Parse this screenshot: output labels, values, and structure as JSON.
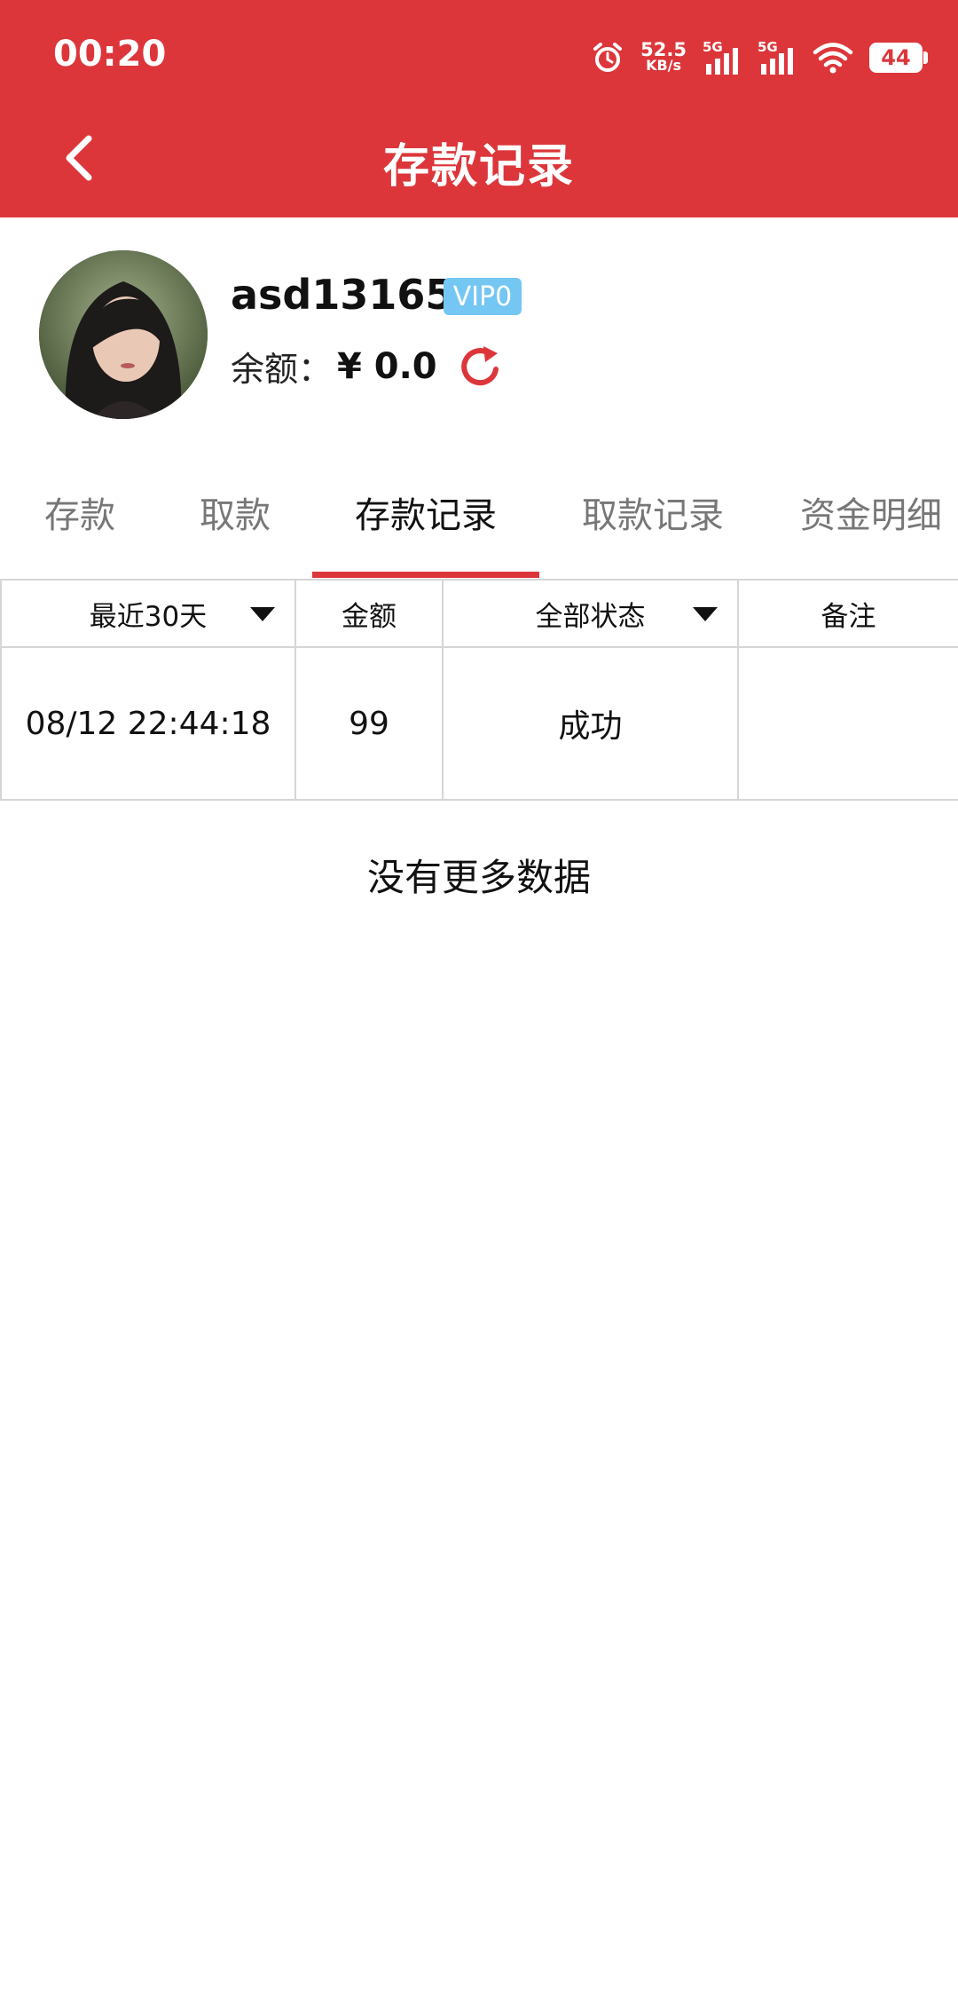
{
  "status_bar": {
    "time": "00:20",
    "net_speed": "52.5",
    "net_unit": "KB/s",
    "signal1_tag": "5G",
    "signal2_tag": "5G",
    "battery": "44"
  },
  "header": {
    "title": "存款记录",
    "back_icon": "chevron-left-icon"
  },
  "profile": {
    "username": "asd131655",
    "vip": "VIP0",
    "balance_label": "余额：",
    "balance_value": "¥ 0.0",
    "refresh_icon": "refresh-icon"
  },
  "tabs": [
    {
      "label": "存款",
      "active": false
    },
    {
      "label": "取款",
      "active": false
    },
    {
      "label": "存款记录",
      "active": true
    },
    {
      "label": "取款记录",
      "active": false
    },
    {
      "label": "资金明细",
      "active": false
    }
  ],
  "table": {
    "headers": [
      {
        "label": "最近30天",
        "dropdown": true
      },
      {
        "label": "金额",
        "dropdown": false
      },
      {
        "label": "全部状态",
        "dropdown": true
      },
      {
        "label": "备注",
        "dropdown": false
      }
    ],
    "rows": [
      {
        "time": "08/12 22:44:18",
        "amount": "99",
        "status": "成功",
        "note": ""
      }
    ]
  },
  "footer_text": "没有更多数据",
  "colors": {
    "brand": "#dc363b",
    "vip_badge": "#74c6f3"
  }
}
